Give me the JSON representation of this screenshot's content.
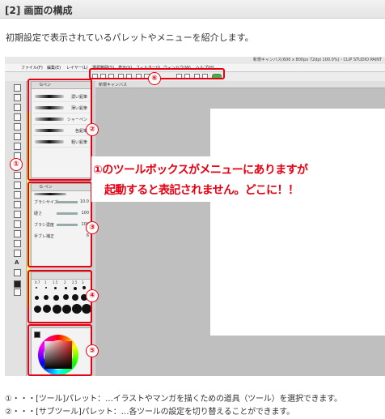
{
  "section": {
    "title": "[2] 画面の構成"
  },
  "intro": "初期設定で表示されているパレットやメニューを紹介します。",
  "app": {
    "window_title": "新規キャンバス(600 x 800px 72dpi 100.0%) - CLIP STUDIO PAINT",
    "menu": [
      "ファイル(F)",
      "編集(E)",
      "レイヤー(L)",
      "選択範囲(S)",
      "表示(V)",
      "フィルター(I)",
      "ウィンドウ(W)",
      "ヘルプ(H)"
    ],
    "doc_tab": "新規キャンバス",
    "subtool_tab": "Gペン",
    "subtools": [
      "濃い鉛筆",
      "薄い鉛筆",
      "シャーペン",
      "色鉛筆",
      "粗い鉛筆"
    ],
    "tool_props_header": "G ペン",
    "tool_props": [
      {
        "label": "ブラシサイズ",
        "value": "10.0"
      },
      {
        "label": "硬さ",
        "value": "100"
      },
      {
        "label": "ブラシ濃度",
        "value": "100"
      },
      {
        "label": "手ブレ補正",
        "value": "6"
      }
    ],
    "brush_sizes": [
      "0.7",
      "1",
      "1.5",
      "2",
      "2.5",
      "3"
    ],
    "toolbox_letter": "A"
  },
  "markers": [
    "①",
    "②",
    "③",
    "④",
    "⑤",
    "⑥"
  ],
  "annotation": {
    "line1": "①のツールボックスがメニューにありますが",
    "line2": "起動すると表記されません。どこに！！"
  },
  "footer": [
    "①・・・[ツール]パレット：…イラストやマンガを描くための道具（ツール）を選択できます。",
    "②・・・[サブツール]パレット：…各ツールの設定を切り替えることができます。"
  ],
  "colors": {
    "marker_red": "#e60012",
    "highlight_yellow": "#fbfb52"
  }
}
